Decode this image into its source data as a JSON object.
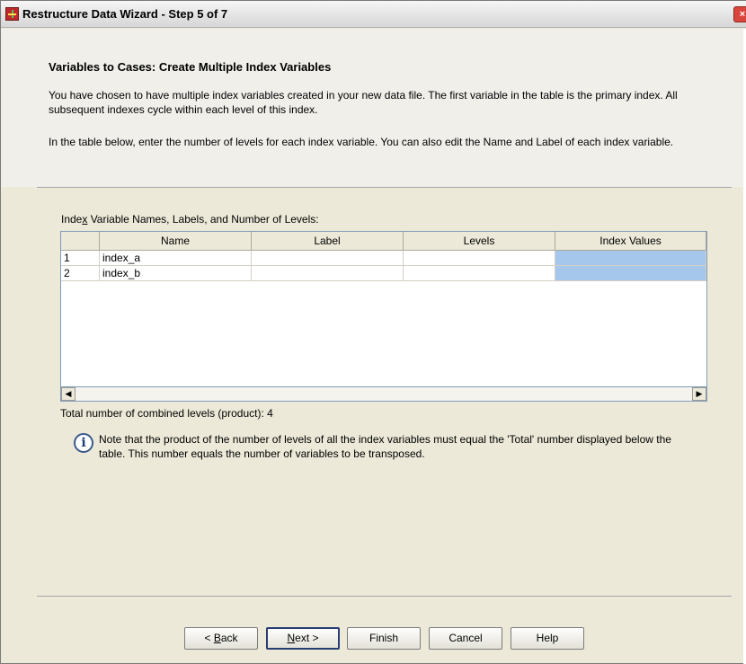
{
  "window": {
    "title": "Restructure Data Wizard - Step 5 of 7",
    "close_glyph": "×"
  },
  "header": {
    "heading": "Variables to Cases: Create Multiple Index Variables",
    "intro1": "You have chosen to have multiple index variables created in your new data file. The first variable in the table is the primary index. All subsequent indexes cycle within each level of this index.",
    "intro2": "In the table below, enter the number of levels for each index variable. You can also edit the Name and Label of each index variable."
  },
  "table": {
    "label_before": "Inde",
    "label_mnemonic": "x",
    "label_after": " Variable Names, Labels, and Number of Levels:",
    "columns": [
      "",
      "Name",
      "Label",
      "Levels",
      "Index Values"
    ],
    "rows": [
      [
        "1",
        "index_a",
        "",
        "",
        ""
      ],
      [
        "2",
        "index_b",
        "",
        "",
        ""
      ]
    ],
    "scroll_left": "◀",
    "scroll_right": "▶"
  },
  "total_text": "Total number of combined levels (product):  4",
  "note": {
    "icon": "info-icon",
    "text": "Note that the product of the number of levels of all the index variables must equal the 'Total' number displayed below the table. This number equals the number of variables to be transposed."
  },
  "buttons": {
    "back_prefix": "< ",
    "back_mnemonic": "B",
    "back_rest": "ack",
    "next_mnemonic": "N",
    "next_rest": "ext >",
    "finish": "Finish",
    "cancel": "Cancel",
    "help": "Help"
  },
  "colors": {
    "dialog_bg": "#ece9d8",
    "selection": "#a6c7ec",
    "title_text": "#000000"
  }
}
